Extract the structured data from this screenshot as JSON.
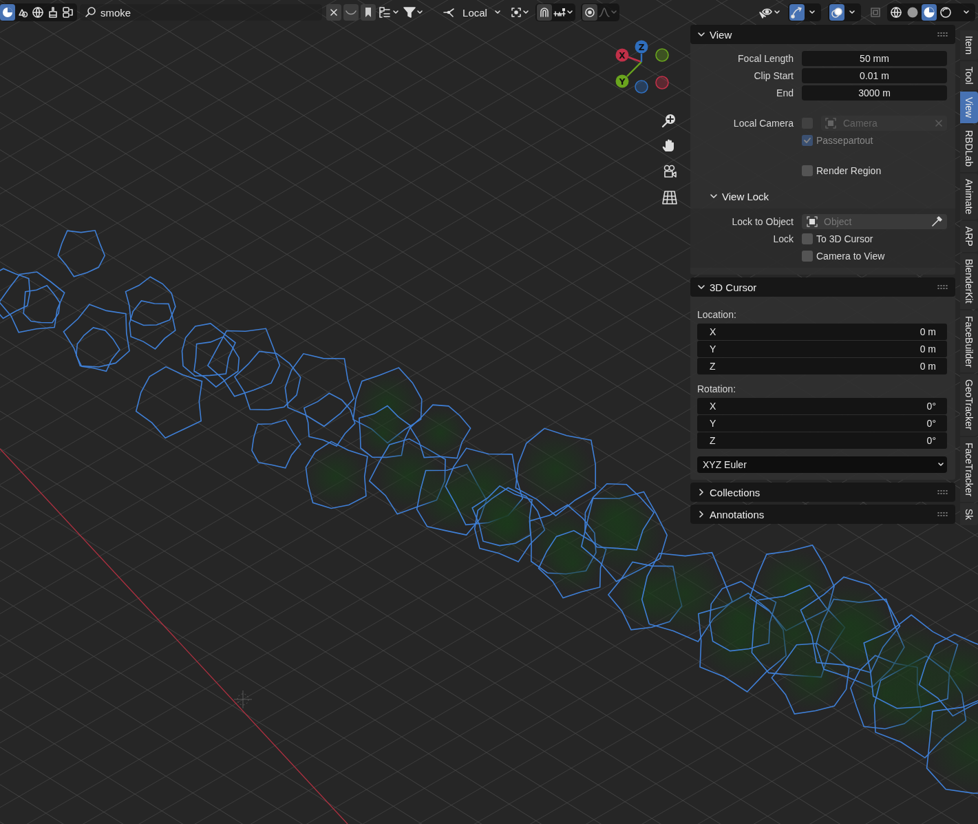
{
  "toolbar": {
    "editor_buttons": [
      {
        "selected": true
      },
      {
        "selected": false
      },
      {
        "selected": false
      },
      {
        "selected": false
      },
      {
        "selected": false
      }
    ],
    "search": {
      "value": "smoke"
    },
    "orientation": {
      "value": "Local"
    },
    "snap": {
      "on": false
    },
    "proportional_edit": {
      "on": false
    },
    "gizmos": {
      "on": true
    },
    "overlays": {
      "on": true
    },
    "xray": {
      "on": false
    },
    "shading_modes": [
      {
        "selected": false
      },
      {
        "selected": false
      },
      {
        "selected": true
      },
      {
        "selected": false
      }
    ]
  },
  "navigation_gizmo": {
    "axes": [
      {
        "label": "X"
      },
      {
        "label": "Y"
      },
      {
        "label": "Z"
      }
    ]
  },
  "sidebar": {
    "panels": [
      {
        "title": "View",
        "expanded": true,
        "rows": [
          {
            "kind": "number",
            "label": "Focal Length",
            "value": "50 mm"
          },
          {
            "kind": "number",
            "label": "Clip Start",
            "value": "0.01 m"
          },
          {
            "kind": "number",
            "label": "End",
            "value": "3000 m"
          },
          {
            "kind": "camera",
            "label": "Local Camera",
            "checked": false,
            "value": "Camera",
            "disabled": true
          },
          {
            "kind": "checkbox",
            "text": "Passepartout",
            "checked": true,
            "disabled": true
          },
          {
            "kind": "checkbox",
            "text": "Render Region",
            "checked": false,
            "disabled": false
          },
          {
            "kind": "subpanel",
            "title": "View Lock",
            "expanded": true,
            "rows": [
              {
                "kind": "object",
                "label": "Lock to Object",
                "placeholder": "Object"
              },
              {
                "kind": "checkbox",
                "label": "Lock",
                "text": "To 3D Cursor",
                "checked": false,
                "disabled": false
              },
              {
                "kind": "checkbox",
                "text": "Camera to View",
                "checked": false,
                "disabled": false
              }
            ]
          }
        ]
      },
      {
        "title": "3D Cursor",
        "expanded": true,
        "rows": [
          {
            "kind": "heading",
            "text": "Location:"
          },
          {
            "kind": "vector",
            "items": [
              {
                "axis": "X",
                "value": "0 m"
              },
              {
                "axis": "Y",
                "value": "0 m"
              },
              {
                "axis": "Z",
                "value": "0 m"
              }
            ]
          },
          {
            "kind": "heading",
            "text": "Rotation:"
          },
          {
            "kind": "vector",
            "items": [
              {
                "axis": "X",
                "value": "0°"
              },
              {
                "axis": "Y",
                "value": "0°"
              },
              {
                "axis": "Z",
                "value": "0°"
              }
            ]
          },
          {
            "kind": "dropdown",
            "value": "XYZ Euler"
          }
        ]
      },
      {
        "title": "Collections",
        "expanded": false
      },
      {
        "title": "Annotations",
        "expanded": false
      }
    ],
    "tabs": [
      {
        "label": "Item",
        "selected": false
      },
      {
        "label": "Tool",
        "selected": false
      },
      {
        "label": "View",
        "selected": true
      },
      {
        "label": "RBDLab",
        "selected": false
      },
      {
        "label": "Animate",
        "selected": false
      },
      {
        "label": "ARP",
        "selected": false
      },
      {
        "label": "BlenderKit",
        "selected": false
      },
      {
        "label": "FaceBuilder",
        "selected": false
      },
      {
        "label": "GeoTracker",
        "selected": false
      },
      {
        "label": "FaceTracker",
        "selected": false
      },
      {
        "label": "Sk",
        "selected": false
      }
    ]
  }
}
